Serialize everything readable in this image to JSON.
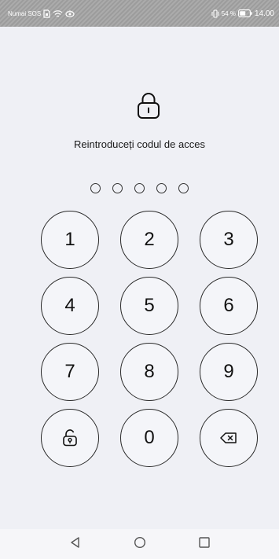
{
  "status_bar": {
    "carrier": "Numai SOS",
    "battery_percent": "54 %",
    "time": "14.00",
    "icons": [
      "sim-icon",
      "wifi-icon",
      "eye-comfort-icon",
      "vibrate-icon",
      "battery-icon"
    ]
  },
  "lock_screen": {
    "lock_icon": "padlock-icon",
    "prompt": "Reintroduceți codul de acces",
    "pin_length": 5,
    "entered_digits": 0
  },
  "keypad": {
    "keys": [
      "1",
      "2",
      "3",
      "4",
      "5",
      "6",
      "7",
      "8",
      "9",
      "",
      "0",
      ""
    ],
    "emergency_icon": "unlock-key-icon",
    "delete_icon": "backspace-icon"
  },
  "nav_bar": {
    "icons": [
      "back-icon",
      "home-icon",
      "recents-icon"
    ]
  },
  "colors": {
    "background": "#eff0f5",
    "status_bar": "#a3a3a3",
    "key_border": "#2a2a2a",
    "text": "#111111"
  }
}
